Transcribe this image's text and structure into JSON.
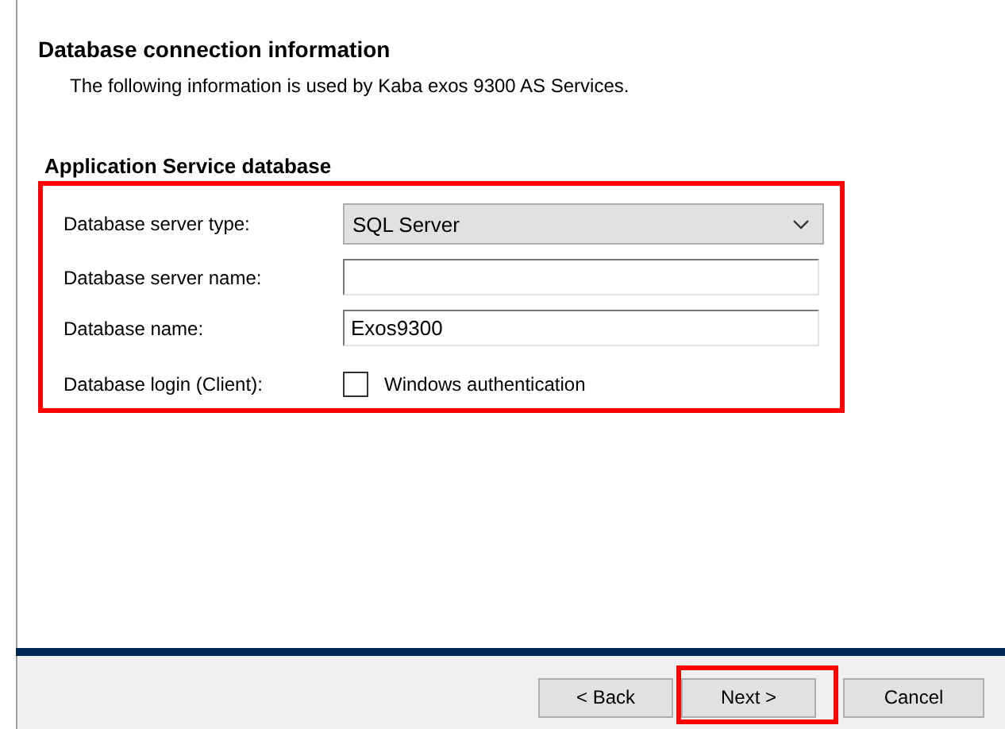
{
  "header": {
    "title": "Database connection information",
    "description": "The following information is used by Kaba exos 9300 AS Services."
  },
  "group": {
    "title": "Application Service database",
    "highlighted": true,
    "fields": [
      {
        "kind": "dropdown",
        "label": "Database server type:",
        "value": "SQL Server"
      },
      {
        "kind": "text",
        "label": "Database server name:"
      },
      {
        "kind": "text",
        "label": "Database name:",
        "value": "Exos9300"
      },
      {
        "kind": "checkbox",
        "label": "Database login (Client):",
        "option": "Windows authentication",
        "checked": false
      }
    ]
  },
  "buttons": [
    {
      "label": "< Back",
      "highlighted": false
    },
    {
      "label": "Next >",
      "highlighted": true
    },
    {
      "label": "Cancel",
      "highlighted": false
    }
  ]
}
